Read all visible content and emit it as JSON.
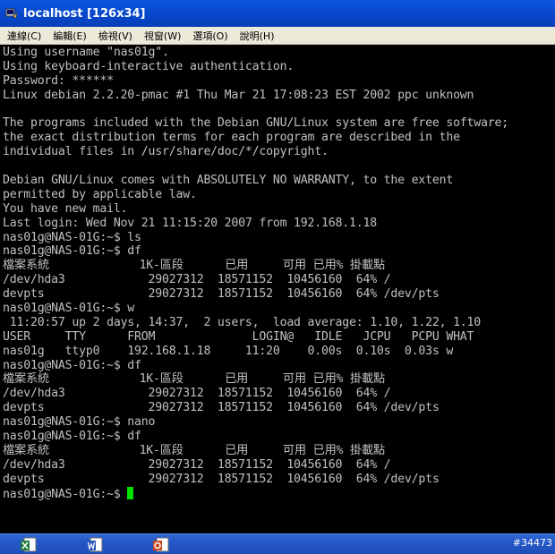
{
  "window": {
    "title": "localhost [126x34]"
  },
  "menu": [
    "連線(C)",
    "編輯(E)",
    "檢視(V)",
    "視窗(W)",
    "選項(O)",
    "說明(H)"
  ],
  "terminal": {
    "lines": [
      "Using username \"nas01g\".",
      "Using keyboard-interactive authentication.",
      "Password: ******",
      "Linux debian 2.2.20-pmac #1 Thu Mar 21 17:08:23 EST 2002 ppc unknown",
      "",
      "The programs included with the Debian GNU/Linux system are free software;",
      "the exact distribution terms for each program are described in the",
      "individual files in /usr/share/doc/*/copyright.",
      "",
      "Debian GNU/Linux comes with ABSOLUTELY NO WARRANTY, to the extent",
      "permitted by applicable law.",
      "You have new mail.",
      "Last login: Wed Nov 21 11:15:20 2007 from 192.168.1.18",
      "nas01g@NAS-01G:~$ ls",
      "nas01g@NAS-01G:~$ df",
      "檔案系統             1K-區段      已用     可用 已用% 掛載點",
      "/dev/hda3            29027312  18571152  10456160  64% /",
      "devpts               29027312  18571152  10456160  64% /dev/pts",
      "nas01g@NAS-01G:~$ w",
      " 11:20:57 up 2 days, 14:37,  2 users,  load average: 1.10, 1.22, 1.10",
      "USER     TTY      FROM              LOGIN@   IDLE   JCPU   PCPU WHAT",
      "nas01g   ttyp0    192.168.1.18     11:20    0.00s  0.10s  0.03s w",
      "nas01g@NAS-01G:~$ df",
      "檔案系統             1K-區段      已用     可用 已用% 掛載點",
      "/dev/hda3            29027312  18571152  10456160  64% /",
      "devpts               29027312  18571152  10456160  64% /dev/pts",
      "nas01g@NAS-01G:~$ nano",
      "nas01g@NAS-01G:~$ df",
      "檔案系統             1K-區段      已用     可用 已用% 掛載點",
      "/dev/hda3            29027312  18571152  10456160  64% /",
      "devpts               29027312  18571152  10456160  64% /dev/pts"
    ],
    "prompt": "nas01g@NAS-01G:~$ ",
    "cursor_color": "#00e000"
  },
  "taskbar": {
    "icons": [
      "excel-icon",
      "word-icon",
      "powerpoint-icon"
    ],
    "counter": "#34473"
  }
}
